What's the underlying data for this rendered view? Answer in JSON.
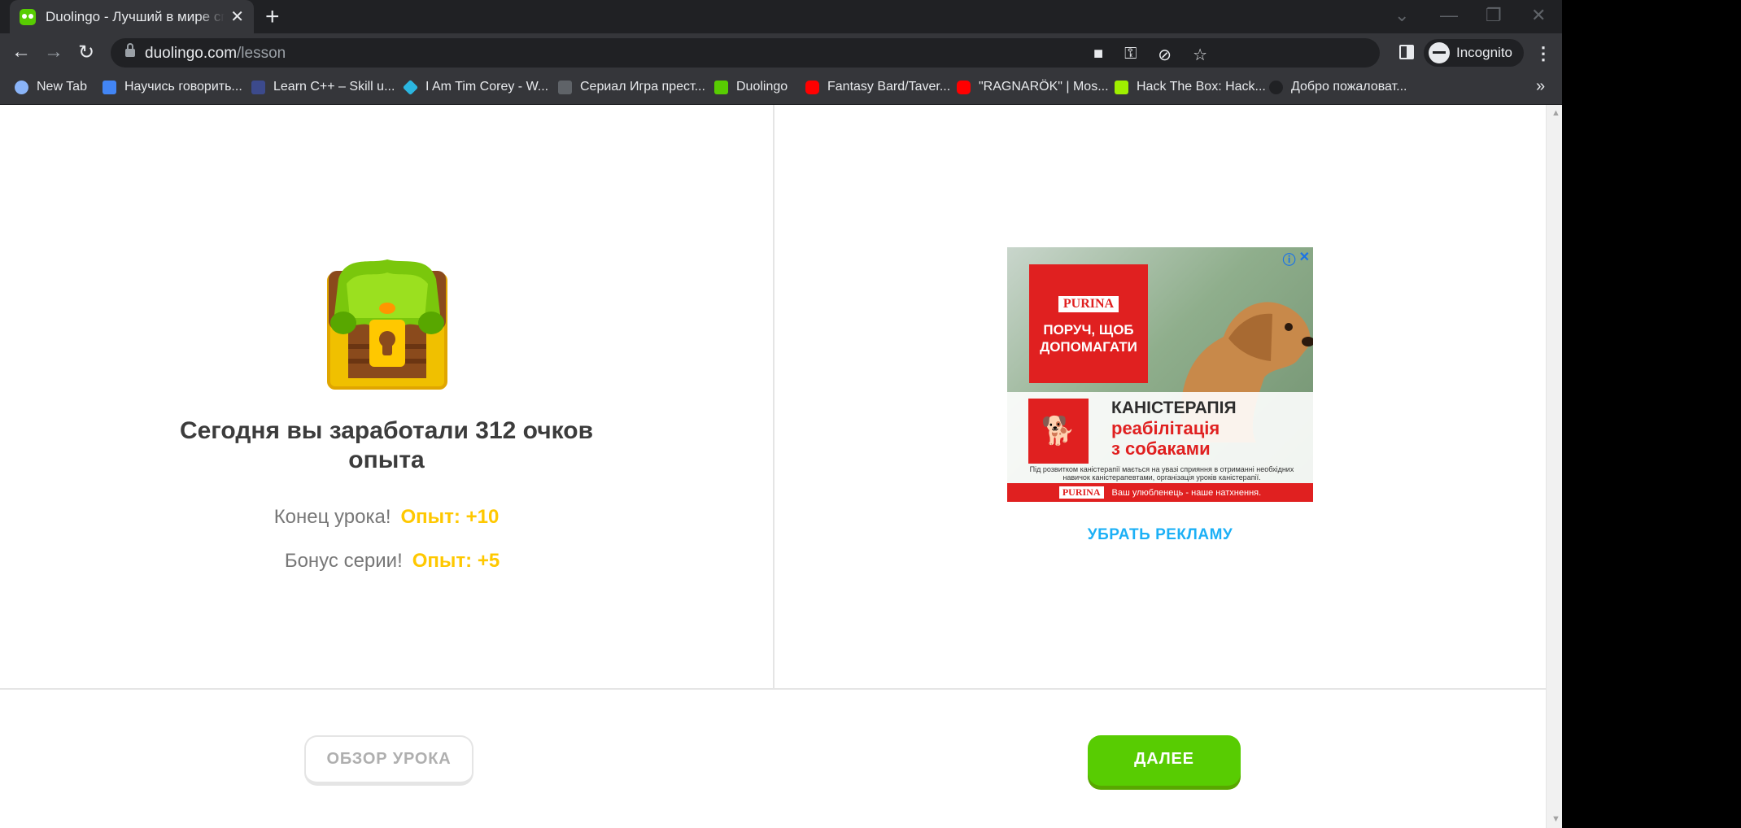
{
  "browser": {
    "tab_title": "Duolingo - Лучший в мире способ изучения языков",
    "tab_close": "✕",
    "new_tab": "+",
    "url_domain": "duolingo.com",
    "url_path": "/lesson",
    "profile_label": "Incognito",
    "bookmarks": [
      {
        "label": "New Tab",
        "color": "#8ab4f8"
      },
      {
        "label": "Научись говорить...",
        "color": "#4285f4"
      },
      {
        "label": "Learn C++ – Skill u...",
        "color": "#3c4a8c"
      },
      {
        "label": "I Am Tim Corey - W...",
        "color": "#2bb6e0"
      },
      {
        "label": "Сериал Игра прест...",
        "color": "#5f6368"
      },
      {
        "label": "Duolingo",
        "color": "#58cc02"
      },
      {
        "label": "Fantasy Bard/Taver...",
        "color": "#ff0000"
      },
      {
        "label": "\"RAGNARÖK\" | Mos...",
        "color": "#ff0000"
      },
      {
        "label": "Hack The Box: Hack...",
        "color": "#9fef00"
      },
      {
        "label": "Добро пожаловат...",
        "color": "#202124"
      }
    ],
    "bookmarks_more": "»"
  },
  "lesson_complete": {
    "headline": "Сегодня вы заработали 312 очков опыта",
    "rows": [
      {
        "label": "Конец урока!",
        "xp": "Опыт: +10"
      },
      {
        "label": "Бонус серии!",
        "xp": "Опыт: +5"
      }
    ]
  },
  "ad": {
    "brand": "PURINA",
    "slogan": "ПОРУЧ, ЩОБ ДОПОМАГАТИ",
    "title": "КАНІСТЕРАПІЯ",
    "subtitle_1": "реабілітація",
    "subtitle_2": "з собаками",
    "fine_print": "Під розвитком каністерапії мається на увазі сприяння в отриманні необхідних навичок каністерапевтами, організація уроків каністерапії.",
    "footer_slogan": "Ваш улюбленець - наше натхнення.",
    "remove_ads": "УБРАТЬ РЕКЛАМУ"
  },
  "footer": {
    "review_button": "ОБЗОР УРОКА",
    "next_button": "ДАЛЕЕ"
  },
  "colors": {
    "xp_gold": "#ffc800",
    "duo_green": "#58cc02",
    "link_blue": "#1cb0f6"
  },
  "icons": [
    "back-arrow-icon",
    "forward-arrow-icon",
    "reload-icon",
    "lock-icon",
    "camera-off-icon",
    "key-icon",
    "eye-off-icon",
    "star-icon",
    "side-panel-icon",
    "incognito-icon",
    "kebab-menu-icon",
    "treasure-chest-icon",
    "adchoices-icon",
    "ad-close-icon"
  ]
}
